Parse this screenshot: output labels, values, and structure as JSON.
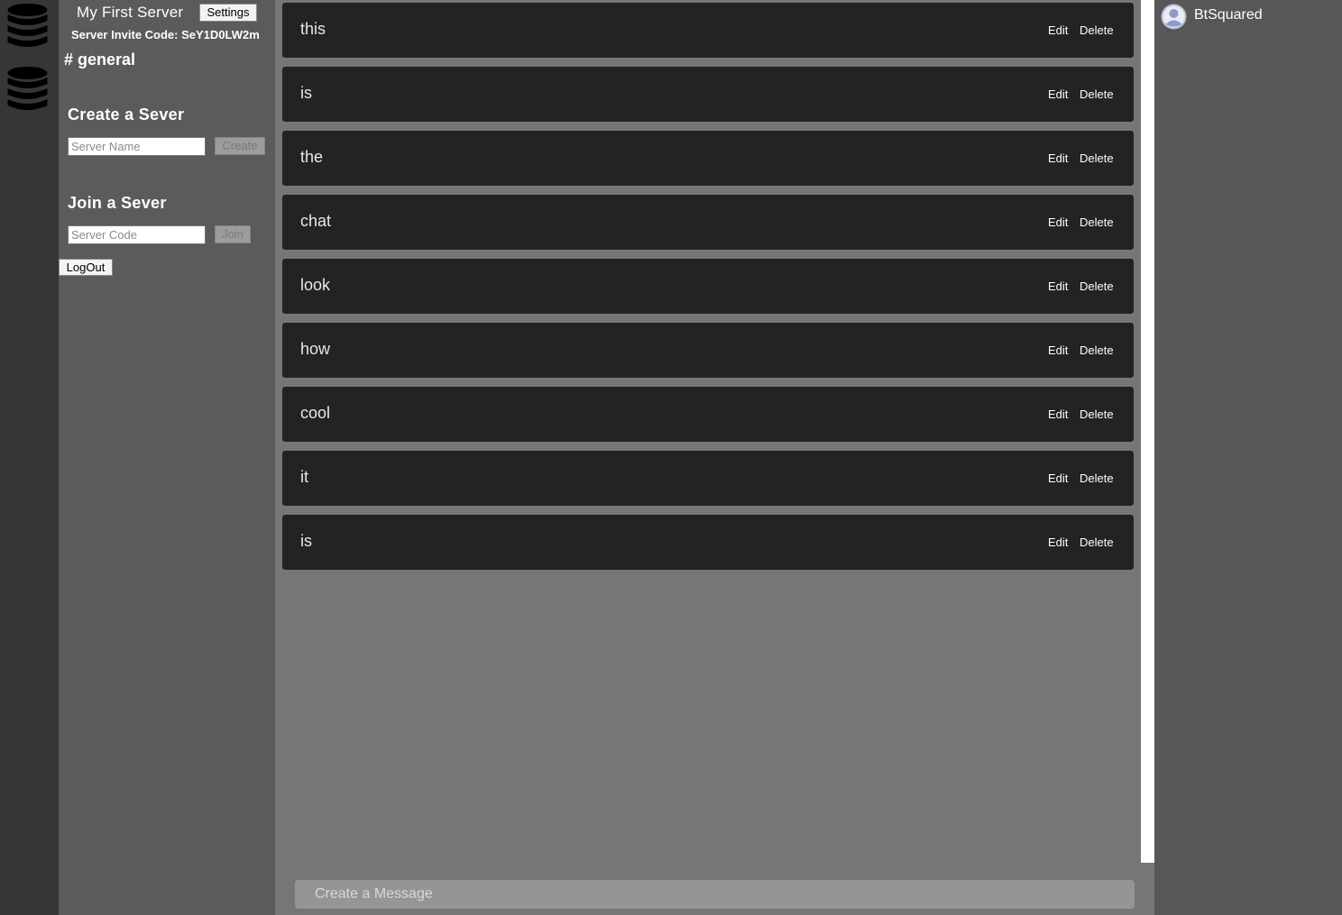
{
  "servers": [
    {
      "icon": "database-icon"
    },
    {
      "icon": "database-icon"
    }
  ],
  "panel": {
    "server_name": "My First Server",
    "settings_label": "Settings",
    "invite_label": "Server Invite Code: SeY1D0LW2m",
    "channel": "# general",
    "create": {
      "heading": "Create a Sever",
      "placeholder": "Server Name",
      "button": "Create"
    },
    "join": {
      "heading": "Join a Sever",
      "placeholder": "Server Code",
      "button": "Join"
    },
    "logout_label": "LogOut"
  },
  "messages": [
    {
      "text": "this",
      "edit": "Edit",
      "delete": "Delete"
    },
    {
      "text": "is",
      "edit": "Edit",
      "delete": "Delete"
    },
    {
      "text": "the",
      "edit": "Edit",
      "delete": "Delete"
    },
    {
      "text": "chat",
      "edit": "Edit",
      "delete": "Delete"
    },
    {
      "text": "look",
      "edit": "Edit",
      "delete": "Delete"
    },
    {
      "text": "how",
      "edit": "Edit",
      "delete": "Delete"
    },
    {
      "text": "cool",
      "edit": "Edit",
      "delete": "Delete"
    },
    {
      "text": "it",
      "edit": "Edit",
      "delete": "Delete"
    },
    {
      "text": "is",
      "edit": "Edit",
      "delete": "Delete"
    }
  ],
  "composer": {
    "placeholder": "Create a Message"
  },
  "users": [
    {
      "name": "BtSquared",
      "avatar_icon": "user-avatar-icon"
    }
  ],
  "colors": {
    "rail": "#363636",
    "panel": "#5b5b5b",
    "main": "#767676",
    "message_bg": "#232323",
    "users_panel": "#575757"
  }
}
